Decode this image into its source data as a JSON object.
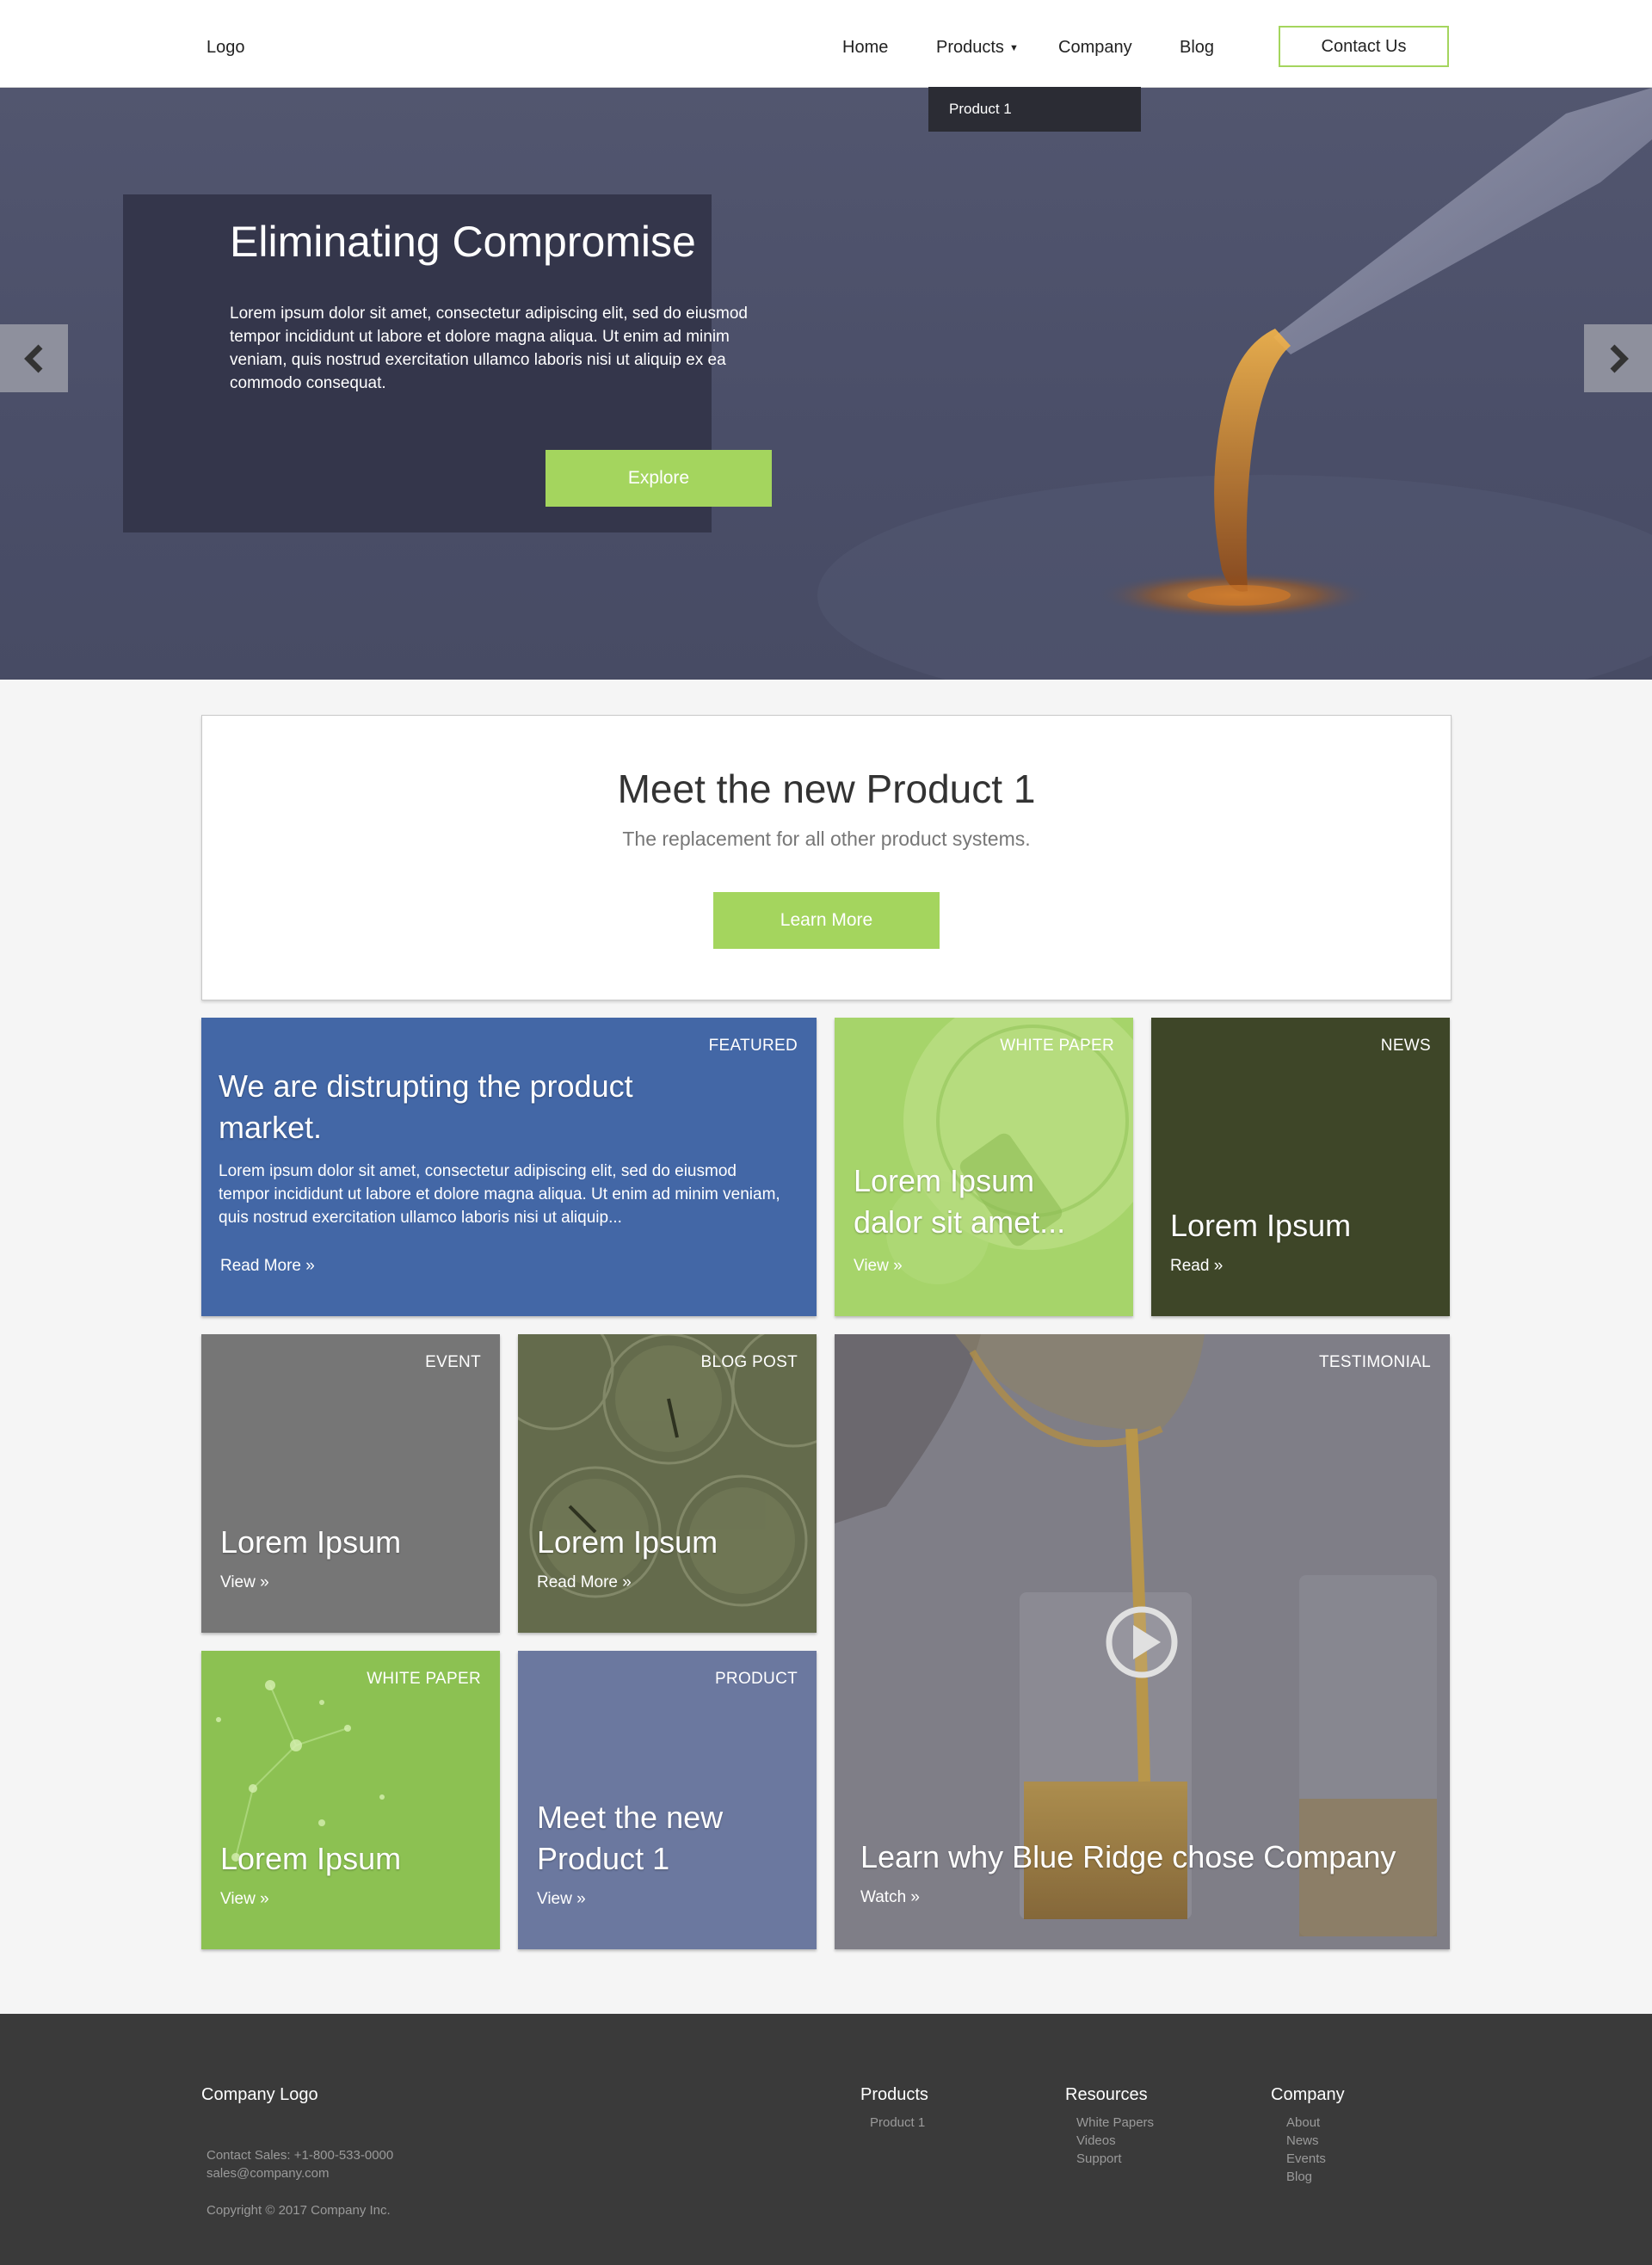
{
  "header": {
    "logo": "Logo",
    "nav": {
      "home": "Home",
      "products": "Products",
      "company": "Company",
      "blog": "Blog"
    },
    "contact_label": "Contact Us",
    "dropdown_item": "Product 1"
  },
  "hero": {
    "title": "Eliminating Compromise",
    "text": "Lorem ipsum dolor sit amet, consectetur adipiscing elit, sed do eiusmod tempor incididunt ut labore et dolore magna aliqua. Ut enim ad minim veniam, quis nostrud exercitation ullamco laboris nisi ut aliquip ex ea commodo consequat.",
    "button": "Explore"
  },
  "promo": {
    "title": "Meet the new Product 1",
    "subtitle": "The replacement for all other product systems.",
    "button": "Learn More"
  },
  "tiles": {
    "featured": {
      "tag": "FEATURED",
      "title": "We are distrupting the product market.",
      "text": "Lorem ipsum dolor sit amet, consectetur adipiscing elit, sed do eiusmod tempor incididunt ut labore et dolore magna aliqua. Ut enim ad minim veniam, quis nostrud exercitation ullamco laboris nisi ut aliquip...",
      "link": "Read More »"
    },
    "white_paper_1": {
      "tag": "WHITE PAPER",
      "title": "Lorem Ipsum dalor sit amet...",
      "link": "View »"
    },
    "news": {
      "tag": "NEWS",
      "title": "Lorem Ipsum",
      "link": "Read »"
    },
    "event": {
      "tag": "EVENT",
      "title": "Lorem Ipsum",
      "link": "View »"
    },
    "blog_post": {
      "tag": "BLOG POST",
      "title": "Lorem Ipsum",
      "link": "Read More »"
    },
    "testimonial": {
      "tag": "TESTIMONIAL",
      "title": "Learn why Blue Ridge chose Company",
      "link": "Watch »"
    },
    "white_paper_2": {
      "tag": "WHITE PAPER",
      "title": "Lorem Ipsum",
      "link": "View »"
    },
    "product": {
      "tag": "PRODUCT",
      "title": "Meet the new Product 1",
      "link": "View »"
    }
  },
  "footer": {
    "logo": "Company Logo",
    "contact_sales": "Contact Sales: +1-800-533-0000",
    "email": "sales@company.com",
    "copyright": "Copyright © 2017 Company Inc.",
    "columns": {
      "products": {
        "title": "Products",
        "links": [
          "Product 1"
        ]
      },
      "resources": {
        "title": "Resources",
        "links": [
          "White Papers",
          "Videos",
          "Support"
        ]
      },
      "company": {
        "title": "Company",
        "links": [
          "About",
          "News",
          "Events",
          "Blog"
        ]
      }
    }
  },
  "colors": {
    "accent_green": "#a4d55e",
    "featured_blue": "#4367a6",
    "news_olive": "#3e4628",
    "event_gray": "#767676",
    "product_slate": "#6b789f",
    "footer_bg": "#3a3a3a"
  },
  "icons": [
    "chevron-left-icon",
    "chevron-right-icon",
    "dropdown-caret-icon",
    "play-icon"
  ]
}
